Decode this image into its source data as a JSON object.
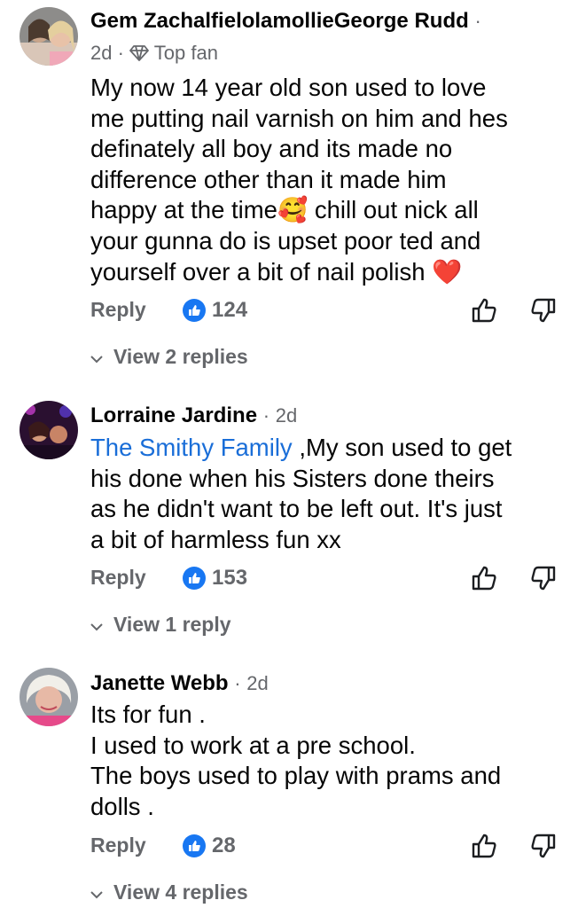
{
  "comments": [
    {
      "author": "Gem ZachalfielolamollieGeorge Rudd",
      "time": "2d",
      "badge": "Top fan",
      "lines": [
        "My now 14 year old son used to love",
        "me putting nail varnish on him and hes",
        "definately all boy and its made no",
        "difference other than it made him",
        "happy at the time🥰 chill out nick all",
        "your gunna do is upset poor ted and",
        "yourself over a bit of nail polish ❤️"
      ],
      "reply_label": "Reply",
      "likes": "124",
      "view_replies": "View 2 replies"
    },
    {
      "author": "Lorraine Jardine",
      "time": "2d",
      "mention": "The Smithy Family",
      "first_line_rest": " ,My son used to get",
      "lines": [
        "his done when his Sisters done theirs",
        "as he didn't want to be left out. It's just",
        "a bit of harmless fun xx"
      ],
      "reply_label": "Reply",
      "likes": "153",
      "view_replies": "View 1 reply"
    },
    {
      "author": "Janette Webb",
      "time": "2d",
      "lines": [
        "Its for fun .",
        "I used to work at a pre school.",
        "The boys used to play with prams and",
        "dolls ."
      ],
      "reply_label": "Reply",
      "likes": "28",
      "view_replies": "View 4 replies"
    }
  ],
  "separator": "·",
  "icons": [
    "diamond-icon",
    "like-reaction-icon",
    "upvote-icon",
    "downvote-icon",
    "chevron-down-icon"
  ],
  "colors": {
    "link": "#1a6ed8",
    "like": "#1877f2",
    "meta": "#65676b"
  }
}
